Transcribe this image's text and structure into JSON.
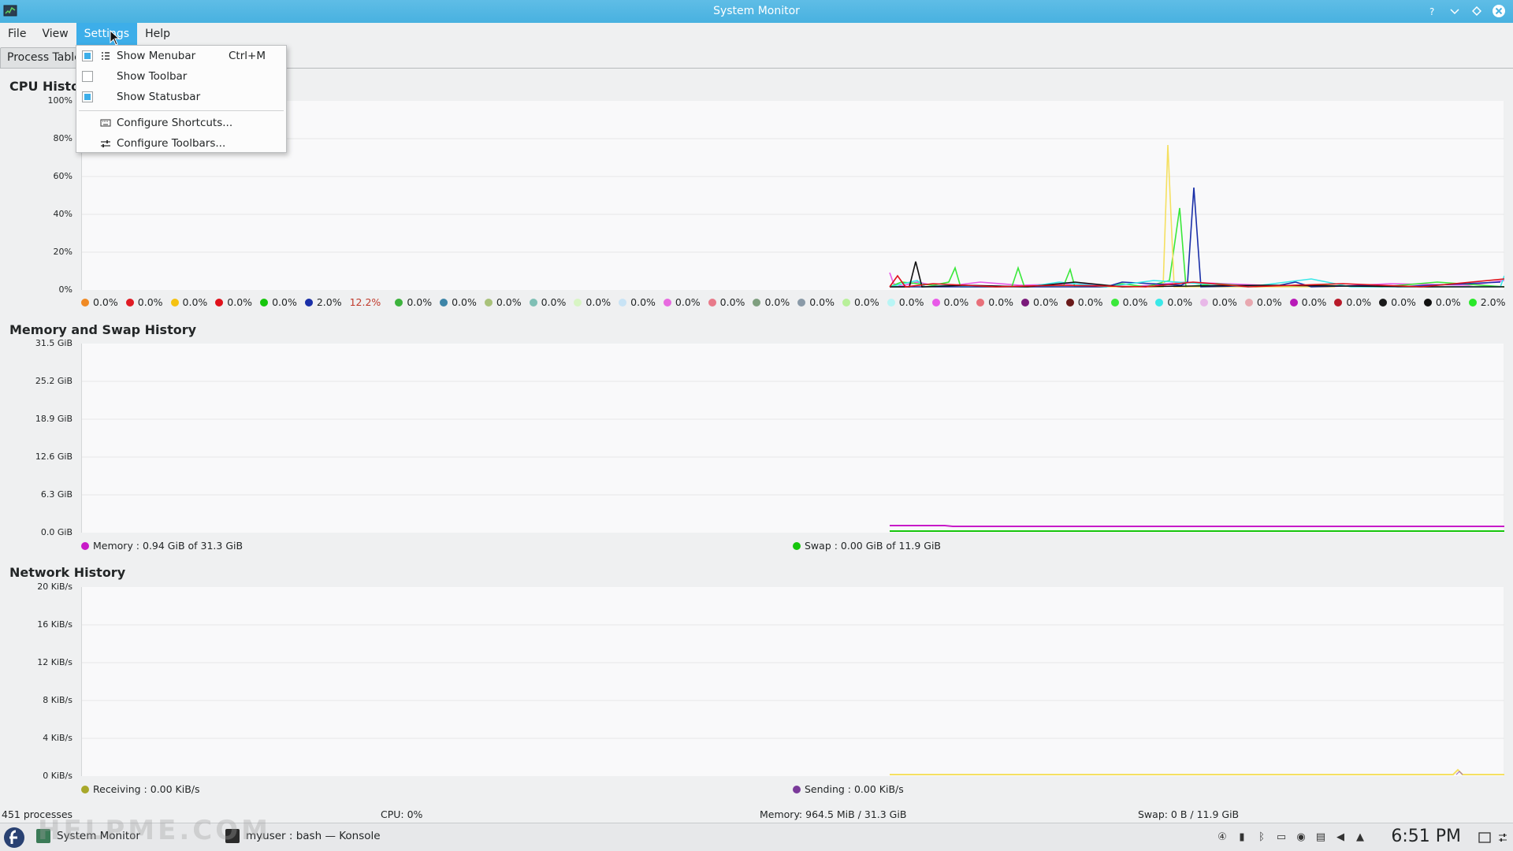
{
  "window": {
    "title": "System Monitor"
  },
  "menubar": {
    "items": [
      "File",
      "View",
      "Settings",
      "Help"
    ]
  },
  "tabs": [
    "Process Table"
  ],
  "settings_menu": {
    "items": [
      {
        "label": "Show Menubar",
        "shortcut": "Ctrl+M",
        "checked": true,
        "icon": "menubar-icon"
      },
      {
        "label": "Show Toolbar",
        "shortcut": "",
        "checked": false,
        "icon": ""
      },
      {
        "label": "Show Statusbar",
        "shortcut": "",
        "checked": true,
        "icon": ""
      },
      {
        "label": "Configure Shortcuts...",
        "shortcut": "",
        "icon": "keyboard-icon"
      },
      {
        "label": "Configure Toolbars...",
        "shortcut": "",
        "icon": "toolbars-icon"
      }
    ]
  },
  "cpu": {
    "title": "CPU History",
    "ylabels": [
      "100%",
      "80%",
      "60%",
      "40%",
      "20%",
      "0%"
    ],
    "legend": [
      {
        "value": "0.0%",
        "color": "#f08a24"
      },
      {
        "value": "0.0%",
        "color": "#e01b24"
      },
      {
        "value": "0.0%",
        "color": "#f5c211"
      },
      {
        "value": "0.0%",
        "color": "#e0111b"
      },
      {
        "value": "0.0%",
        "color": "#16c60c"
      },
      {
        "value": "2.0%",
        "color": "#1a2fa8"
      },
      {
        "value": "12.2%",
        "color": "",
        "extra": true
      },
      {
        "value": "0.0%",
        "color": "#3db33d"
      },
      {
        "value": "0.0%",
        "color": "#3d85a8"
      },
      {
        "value": "0.0%",
        "color": "#a9c27a"
      },
      {
        "value": "0.0%",
        "color": "#7fbfb5"
      },
      {
        "value": "0.0%",
        "color": "#d8f5c4"
      },
      {
        "value": "0.0%",
        "color": "#c8e3f5"
      },
      {
        "value": "0.0%",
        "color": "#e86ae0"
      },
      {
        "value": "0.0%",
        "color": "#e87a8a"
      },
      {
        "value": "0.0%",
        "color": "#7f9f7f"
      },
      {
        "value": "0.0%",
        "color": "#8a9aa8"
      },
      {
        "value": "0.0%",
        "color": "#b8f09a"
      },
      {
        "value": "0.0%",
        "color": "#b8f5f5"
      },
      {
        "value": "0.0%",
        "color": "#e85ae8"
      },
      {
        "value": "0.0%",
        "color": "#e8707a"
      },
      {
        "value": "0.0%",
        "color": "#7a1a7a"
      },
      {
        "value": "0.0%",
        "color": "#6a1a1a"
      },
      {
        "value": "0.0%",
        "color": "#3ae83a"
      },
      {
        "value": "0.0%",
        "color": "#3ae8e8"
      },
      {
        "value": "0.0%",
        "color": "#e8b8e8"
      },
      {
        "value": "0.0%",
        "color": "#e8a8b0"
      },
      {
        "value": "0.0%",
        "color": "#b81ab8"
      },
      {
        "value": "0.0%",
        "color": "#b81a2a"
      },
      {
        "value": "0.0%",
        "color": "#1a1a1a"
      },
      {
        "value": "0.0%",
        "color": "#111111"
      },
      {
        "value": "2.0%",
        "color": "#2ae82a"
      }
    ]
  },
  "memory": {
    "title": "Memory and Swap History",
    "ylabels": [
      "31.5 GiB",
      "25.2 GiB",
      "18.9 GiB",
      "12.6 GiB",
      "6.3 GiB",
      "0.0 GiB"
    ],
    "memory_label": "Memory : 0.94 GiB of 31.3 GiB",
    "swap_label": "Swap : 0.00 GiB of 11.9 GiB",
    "memory_color": "#c81ac8",
    "swap_color": "#16c60c"
  },
  "network": {
    "title": "Network History",
    "ylabels": [
      "20 KiB/s",
      "16 KiB/s",
      "12 KiB/s",
      "8 KiB/s",
      "4 KiB/s",
      "0 KiB/s"
    ],
    "receiving_label": "Receiving : 0.00 KiB/s",
    "sending_label": "Sending : 0.00 KiB/s",
    "receiving_color": "#a8a82a",
    "sending_color": "#7a3a9a"
  },
  "statusbar": {
    "processes": "451 processes",
    "cpu": "CPU: 0%",
    "memory": "Memory: 964.5 MiB / 31.3 GiB",
    "swap": "Swap: 0 B / 11.9 GiB"
  },
  "taskbar": {
    "tasks": [
      "System Monitor",
      "myuser : bash — Konsole"
    ],
    "clock": "6:51 PM",
    "watermark": "HELPME.COM"
  }
}
